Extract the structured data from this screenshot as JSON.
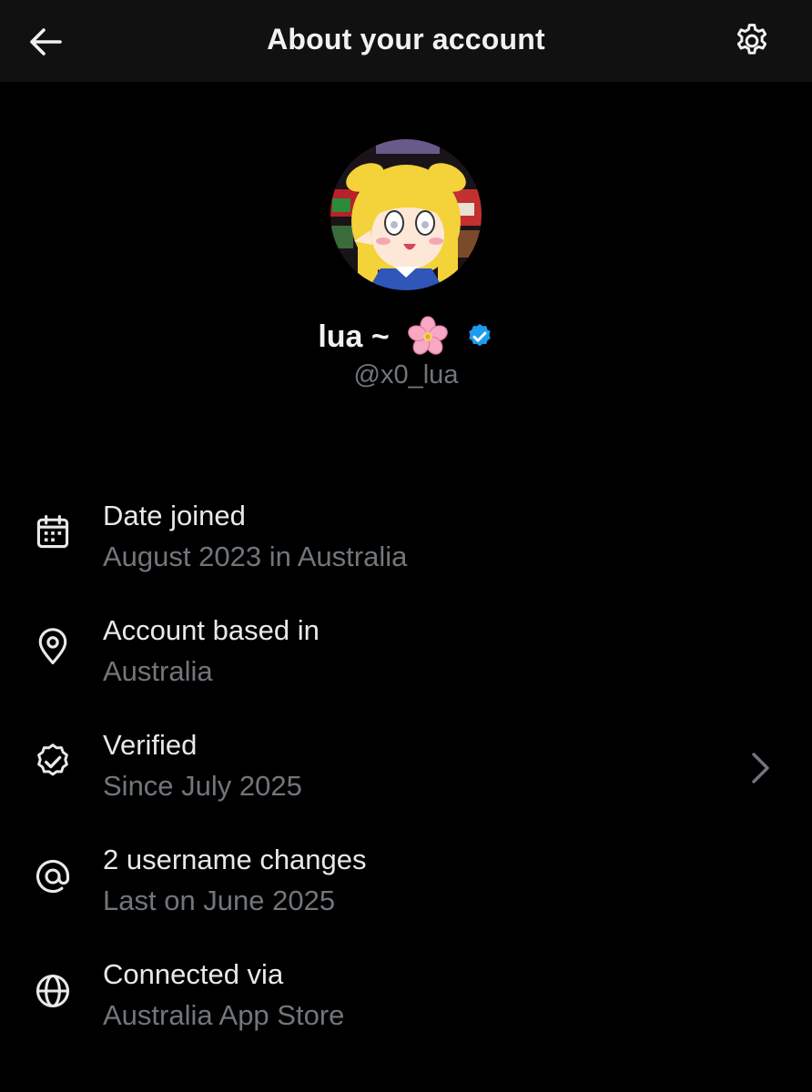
{
  "header": {
    "title": "About your account",
    "back_icon": "arrow-left-icon",
    "settings_icon": "gear-icon"
  },
  "profile": {
    "display_name": "lua ~",
    "display_name_emoji": "cherry-blossom",
    "handle": "@x0_lua",
    "verified": true,
    "verified_color": "#1d9bf0"
  },
  "details": [
    {
      "icon": "calendar-icon",
      "label": "Date joined",
      "value": "August 2023 in Australia"
    },
    {
      "icon": "location-pin-icon",
      "label": "Account based in",
      "value": "Australia"
    },
    {
      "icon": "verified-badge-icon",
      "label": "Verified",
      "value": "Since July 2025"
    },
    {
      "icon": "at-sign-icon",
      "label": "2 username changes",
      "value": "Last on June 2025"
    },
    {
      "icon": "globe-icon",
      "label": "Connected via",
      "value": "Australia App Store"
    }
  ],
  "colors": {
    "background": "#000000",
    "header_background": "#111111",
    "primary_text": "#e7e9ea",
    "secondary_text": "#71767b",
    "accent": "#1d9bf0"
  }
}
